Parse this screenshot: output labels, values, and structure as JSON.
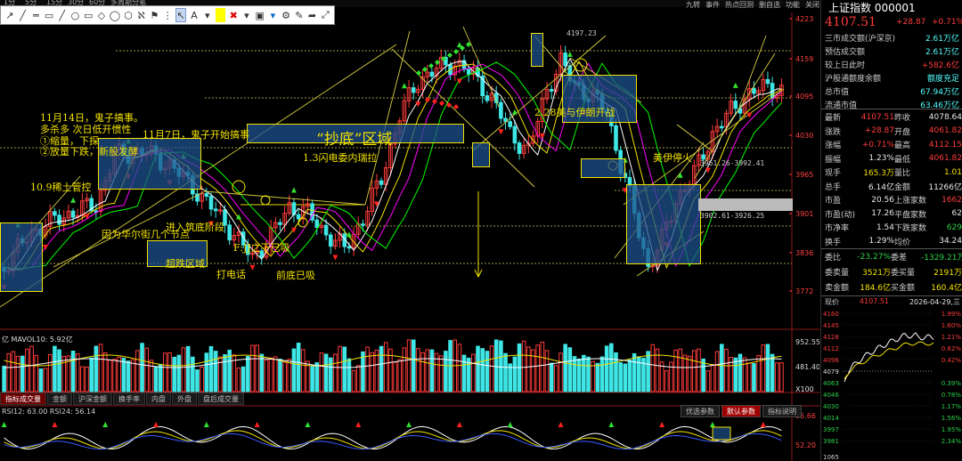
{
  "toolbar_top": {
    "periods": [
      "1分",
      "5分",
      "15分",
      "30分",
      "60分",
      "多周期",
      "分笔"
    ],
    "right": [
      "九转",
      "事件",
      "热点回测",
      "删自选",
      "功能",
      "关闭"
    ]
  },
  "draw_tools": [
    "↗",
    "╱",
    "═",
    "▭",
    "╱",
    "○",
    "▭",
    "◇",
    "◯",
    "⬡",
    "ℵ",
    "⚑",
    "⋮",
    "↖",
    "A",
    "▾",
    "■",
    "✖",
    "▾",
    "▣",
    "▾",
    "⚙",
    "✎",
    "➦",
    "⤢"
  ],
  "index": {
    "name": "上证指数",
    "code": "000001",
    "price": "4107.51",
    "change": "+28.87",
    "pct": "+0.71%"
  },
  "stats": [
    {
      "label": "三市成交额(沪深京)",
      "value": "2.61万亿",
      "color": "cyan"
    },
    {
      "label": "预估成交额",
      "value": "2.61万亿",
      "color": "cyan"
    },
    {
      "label": "较上日此时",
      "value": "+582.6亿",
      "color": "red"
    },
    {
      "label": "沪股通额度余额",
      "value": "额度充足",
      "color": "cyan"
    },
    {
      "label": "总市值",
      "value": "67.94万亿",
      "color": "cyan"
    },
    {
      "label": "流通市值",
      "value": "63.46万亿",
      "color": "cyan"
    }
  ],
  "quote": [
    [
      "最新",
      "4107.51",
      "昨收",
      "4078.64"
    ],
    [
      "涨跌",
      "+28.87",
      "开盘",
      "4061.82"
    ],
    [
      "涨幅",
      "+0.71%",
      "最高",
      "4112.15"
    ],
    [
      "振幅",
      "1.23%",
      "最低",
      "4061.82"
    ],
    [
      "现手",
      "165.3万",
      "量比",
      "1.01"
    ],
    [
      "总手",
      "6.14亿",
      "金额",
      "11266亿"
    ],
    [
      "市盈",
      "20.56",
      "上涨家数",
      "1662"
    ],
    [
      "市盈(动)",
      "17.26",
      "平盘家数",
      "62"
    ],
    [
      "市净率",
      "1.54",
      "下跌家数",
      "629"
    ],
    [
      "换手",
      "1.29%",
      "均价",
      "34.24"
    ]
  ],
  "quote_colors": [
    [
      "red",
      "white"
    ],
    [
      "red",
      "red"
    ],
    [
      "red",
      "red"
    ],
    [
      "white",
      "red"
    ],
    [
      "yellow",
      "yellow"
    ],
    [
      "white",
      "white"
    ],
    [
      "white",
      "red"
    ],
    [
      "white",
      "white"
    ],
    [
      "white",
      "green"
    ],
    [
      "white",
      "white"
    ]
  ],
  "commission": [
    [
      "委比",
      "-23.27%",
      "委差",
      "-1329.21万"
    ],
    [
      "委卖量",
      "3521万",
      "委买量",
      "2191万"
    ],
    [
      "卖金额",
      "184.6亿",
      "买金额",
      "160.4亿"
    ]
  ],
  "mini": {
    "label": "现价",
    "price": "4107.51",
    "date": "2026-04-29,三",
    "left_ticks": [
      "4160",
      "4145",
      "4128",
      "4112",
      "4096",
      "4079",
      "4063",
      "4046",
      "4030",
      "4014",
      "3997",
      "3981"
    ],
    "right_ticks": [
      "1.99%",
      "1.60%",
      "1.21%",
      "0.82%",
      "0.42%",
      "",
      "0.39%",
      "0.78%",
      "1.17%",
      "1.56%",
      "1.95%",
      "2.34%"
    ],
    "vol_label": "1065"
  },
  "price_axis": [
    "4223",
    "4159",
    "4095",
    "4030",
    "3965",
    "3901",
    "3836",
    "3772"
  ],
  "vol_axis": [
    "952.55万",
    "481.40万",
    "X100"
  ],
  "rsi_axis": [
    "95.66",
    "52.20"
  ],
  "vol_title": "亿 MAVOL10: 5.92亿",
  "rsi_title": "RSI12: 63.00  RSI24: 56.14",
  "tabs": [
    "指标成交量",
    "金额",
    "沪深金额",
    "换手率",
    "内盘",
    "外盘",
    "盘后成交量"
  ],
  "param_tabs": [
    "优选参数",
    "默认参数",
    "指标说明"
  ],
  "annotations": {
    "a1": "11月14日，鬼子搞事。",
    "a2": "多杀多   次日低开惯性",
    "a3": "①缩量，下探",
    "a4": "②放量下跌，新股发酵",
    "a5": "11月7日，鬼子开始搞事",
    "a6": "10.9稀土管控",
    "a7": "因为华尔街几个节点",
    "a8": "超跌区域",
    "a9": "打电话",
    "a10": "前底已吸",
    "a11": "F:JJ之下已吸",
    "a12": "“抄底”区域",
    "a13": "1.3闪电委内瑞拉",
    "a14": "2.28美与伊朗开战",
    "a15": "美伊停火",
    "a16": "4197.23",
    "a17": "3961.26-3992.41",
    "a18": "3902.61-3926.25",
    "a19": "进入筑底阶段"
  }
}
